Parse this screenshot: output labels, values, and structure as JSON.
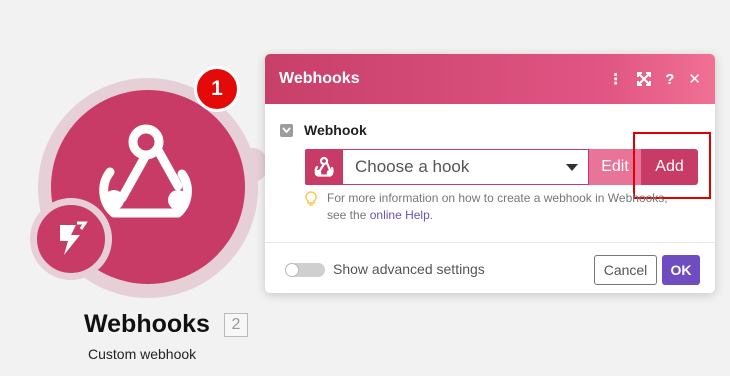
{
  "module": {
    "title": "Webhooks",
    "id": "2",
    "subtitle": "Custom webhook",
    "notification_count": "1",
    "icon": "webhook-icon",
    "sub_icon": "lightning-icon",
    "color": "#c73b66"
  },
  "dialog": {
    "title": "Webhooks",
    "header_icons": [
      "more-vertical-icon",
      "expand-icon",
      "help-icon",
      "close-icon"
    ],
    "header_icon_glyphs": {
      "more": "⋮",
      "expand": "⤢",
      "help": "?",
      "close": "✕"
    },
    "section_label": "Webhook",
    "hook_select": {
      "placeholder": "Choose a hook"
    },
    "edit_label": "Edit",
    "add_label": "Add",
    "help_text": "For more information on how to create a webhook in Webhooks,",
    "help_text_2": "see the",
    "help_link": "online Help",
    "help_end": ".",
    "advanced_label": "Show advanced settings",
    "cancel_label": "Cancel",
    "ok_label": "OK"
  },
  "colors": {
    "accent": "#c73b66",
    "ok_button": "#6f4cc0",
    "link": "#6c52b5",
    "notification": "#e40a0a",
    "highlight": "#e00000"
  }
}
